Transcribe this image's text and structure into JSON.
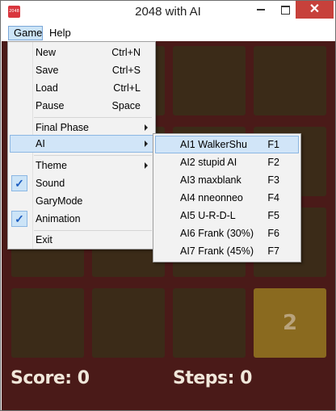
{
  "window": {
    "title": "2048 with AI",
    "icon_text": "2048",
    "icon_color": "#d9363e"
  },
  "menubar": {
    "items": [
      {
        "label": "Game"
      },
      {
        "label": "Help"
      }
    ]
  },
  "game_menu": {
    "items": [
      {
        "label": "New",
        "accel": "Ctrl+N"
      },
      {
        "label": "Save",
        "accel": "Ctrl+S"
      },
      {
        "label": "Load",
        "accel": "Ctrl+L"
      },
      {
        "label": "Pause",
        "accel": "Space"
      },
      {
        "label": "Final Phase",
        "submenu": true
      },
      {
        "label": "AI",
        "submenu": true,
        "highlighted": true
      },
      {
        "label": "Theme",
        "submenu": true
      },
      {
        "label": "Sound",
        "checked": true
      },
      {
        "label": "GaryMode",
        "checked": false
      },
      {
        "label": "Animation",
        "checked": true
      },
      {
        "label": "Exit"
      }
    ]
  },
  "ai_menu": {
    "items": [
      {
        "label": "AI1 WalkerShu",
        "accel": "F1",
        "highlighted": true
      },
      {
        "label": "AI2 stupid AI",
        "accel": "F2"
      },
      {
        "label": "AI3 maxblank",
        "accel": "F3"
      },
      {
        "label": "AI4 nneonneo",
        "accel": "F4"
      },
      {
        "label": "AI5 U-R-D-L",
        "accel": "F5"
      },
      {
        "label": "AI6 Frank (30%)",
        "accel": "F6"
      },
      {
        "label": "AI7 Frank (45%)",
        "accel": "F7"
      }
    ]
  },
  "board": {
    "tiles": [
      {
        "row": 4,
        "col": 4,
        "value": "2"
      }
    ],
    "background_color": "#4a1a18",
    "empty_tile_color": "#3b2b18",
    "tile_2_color": "#8a6a1f"
  },
  "status": {
    "score_text": "Score: 0",
    "steps_text": "Steps: 0"
  }
}
